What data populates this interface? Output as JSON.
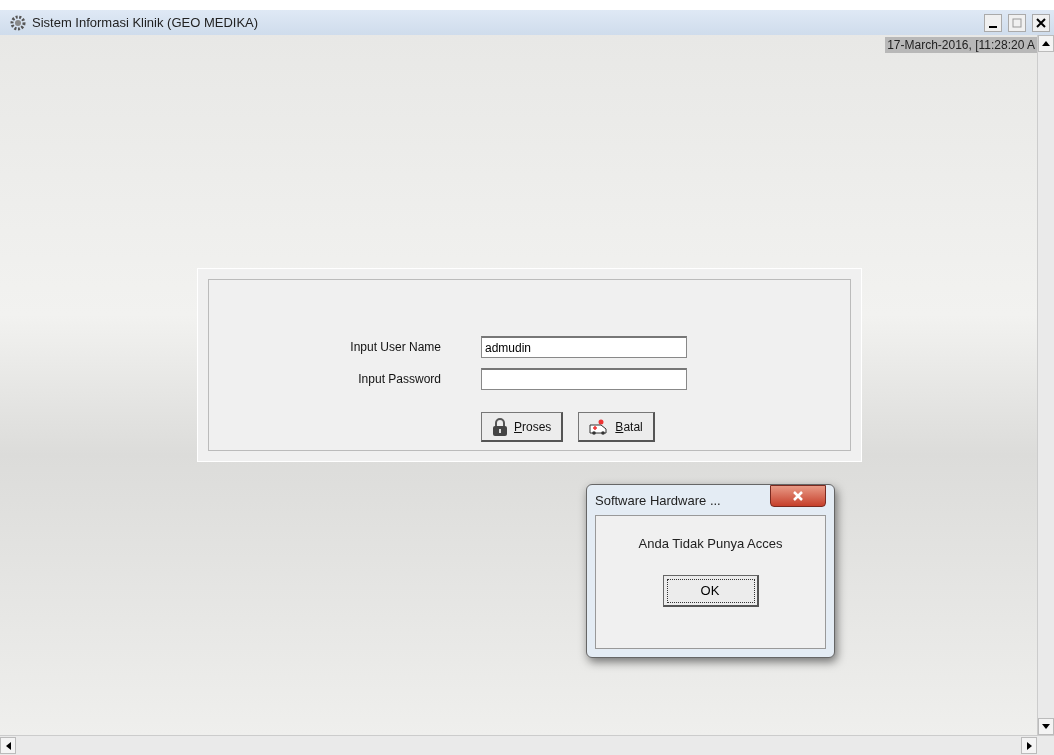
{
  "window": {
    "title": "Sistem Informasi Klinik (GEO MEDIKA)"
  },
  "clock": "17-March-2016, [11:28:20 A",
  "login": {
    "fields": [
      {
        "label": "Input User Name",
        "value": "admudin"
      },
      {
        "label": "Input Password"
      }
    ],
    "buttons": [
      {
        "kind": "lock",
        "label": "Proses"
      },
      {
        "kind": "ambulance",
        "label": "Batal"
      }
    ]
  },
  "dialog": {
    "title": "Software  Hardware ...",
    "message": "Anda Tidak Punya Acces",
    "button": "OK"
  }
}
